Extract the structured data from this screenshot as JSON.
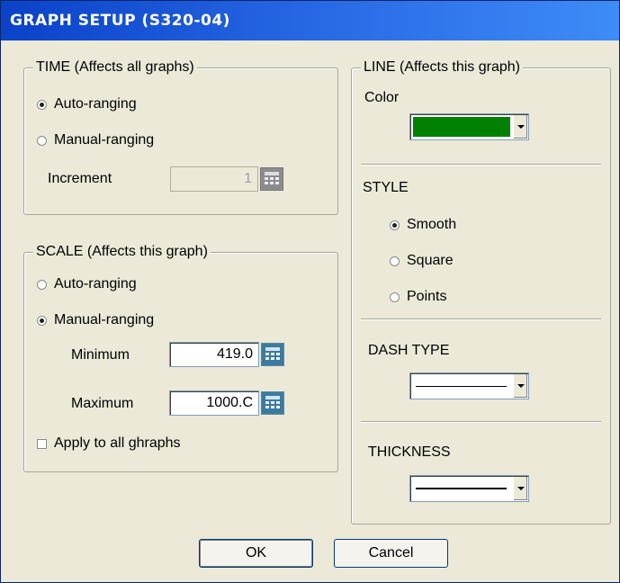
{
  "window": {
    "title": "GRAPH SETUP (S320-04)"
  },
  "time_group": {
    "legend": "TIME (Affects all graphs)",
    "auto_label": "Auto-ranging",
    "manual_label": "Manual-ranging",
    "selected": "auto",
    "increment_label": "Increment",
    "increment_value": "1"
  },
  "scale_group": {
    "legend": "SCALE (Affects this graph)",
    "auto_label": "Auto-ranging",
    "manual_label": "Manual-ranging",
    "selected": "manual",
    "minimum_label": "Minimum",
    "minimum_value": "419.0",
    "maximum_label": "Maximum",
    "maximum_value": "1000.C",
    "apply_all_label": "Apply to all ghraphs",
    "apply_all_checked": false
  },
  "line_group": {
    "legend": "LINE (Affects this graph)",
    "color_label": "Color",
    "color_value": "#008000",
    "style_label": "STYLE",
    "style_options": [
      "Smooth",
      "Square",
      "Points"
    ],
    "style_selected": "Smooth",
    "dash_label": "DASH TYPE",
    "dash_value": "solid",
    "thickness_label": "THICKNESS",
    "thickness_value": "thick"
  },
  "buttons": {
    "ok": "OK",
    "cancel": "Cancel"
  },
  "colors": {
    "title_bar": "#0a42c8",
    "dialog_bg": "#ece9d8",
    "calc_button": "#3d7a9e"
  },
  "icons": {
    "calc_button": "calculator-icon",
    "dropdown": "chevron-down-icon"
  }
}
